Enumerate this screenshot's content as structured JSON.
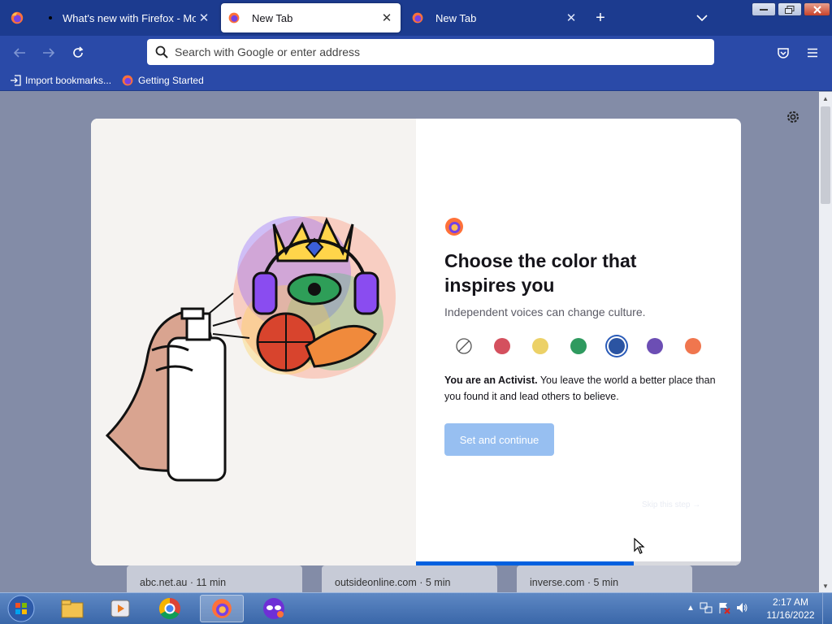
{
  "tabs": [
    {
      "title": "What's new with Firefox - More"
    },
    {
      "title": "New Tab"
    },
    {
      "title": "New Tab"
    }
  ],
  "urlbar": {
    "placeholder": "Search with Google or enter address"
  },
  "bookmarks": [
    {
      "label": "Import bookmarks..."
    },
    {
      "label": "Getting Started"
    }
  ],
  "modal": {
    "heading": "Choose the color that inspires you",
    "subtitle": "Independent voices can change culture.",
    "swatches": [
      {
        "name": "none",
        "color": "#ffffff"
      },
      {
        "name": "red",
        "color": "#d4505e"
      },
      {
        "name": "yellow",
        "color": "#ecd167"
      },
      {
        "name": "green",
        "color": "#2f9a5f"
      },
      {
        "name": "blue",
        "color": "#2b54a2",
        "selected": true
      },
      {
        "name": "purple",
        "color": "#6c4eb4"
      },
      {
        "name": "orange",
        "color": "#f0764e"
      }
    ],
    "desc_bold": "You are an Activist.",
    "desc_text": " You leave the world a better place than you found it and lead others to believe.",
    "primary_button": "Set and continue",
    "skip_link": "Skip this step →",
    "progress": 0.67
  },
  "tiles": [
    {
      "label": "abc.net.au · 11 min"
    },
    {
      "label": "outsideonline.com · 5 min"
    },
    {
      "label": "inverse.com · 5 min"
    }
  ],
  "taskbar": {
    "time": "2:17 AM",
    "date": "11/16/2022"
  }
}
